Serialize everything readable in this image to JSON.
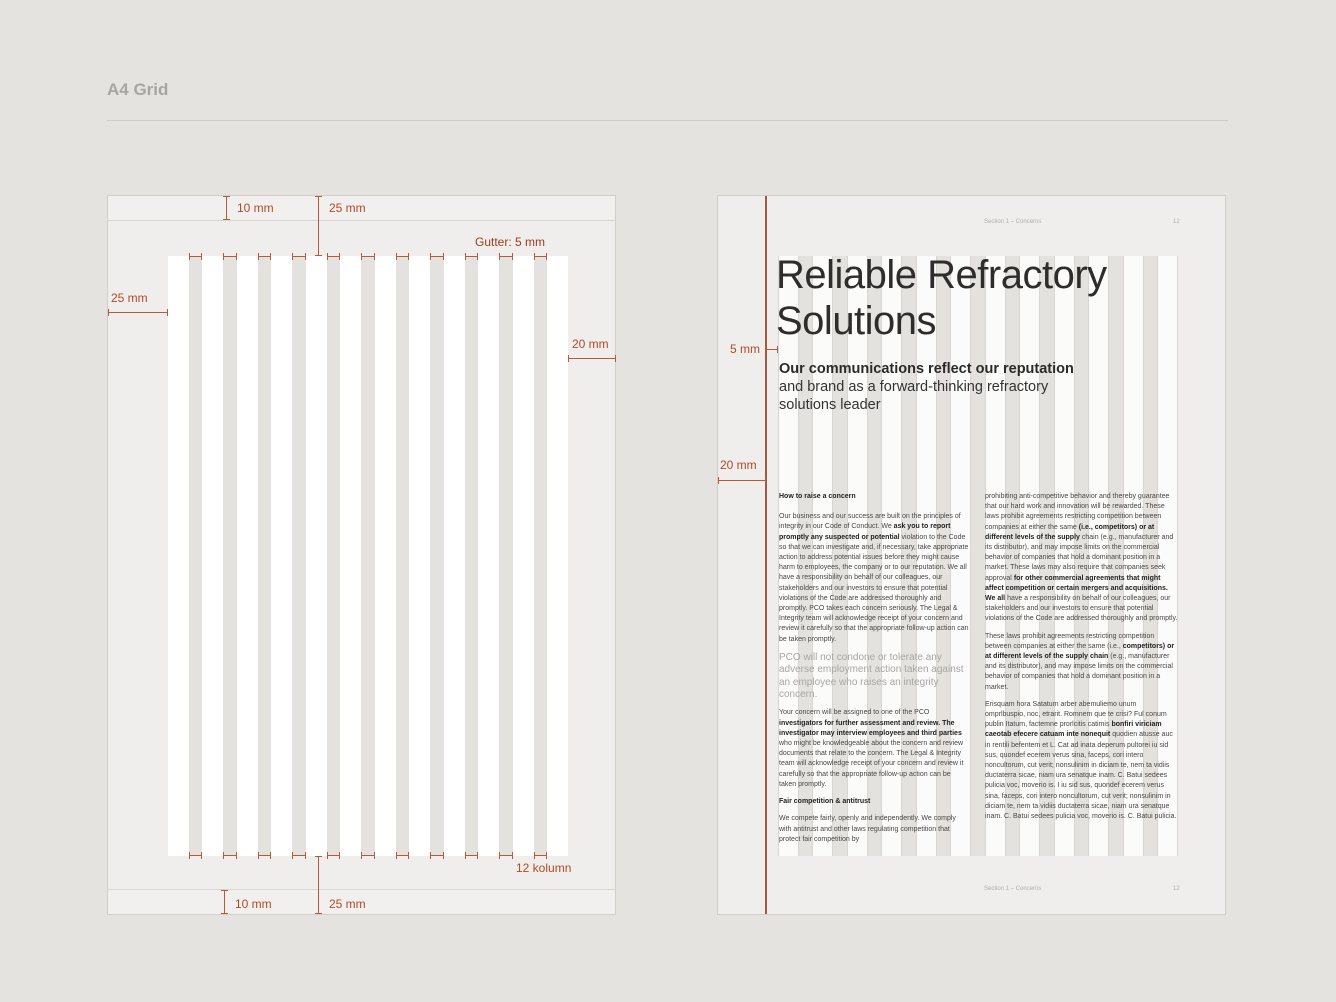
{
  "title": "A4 Grid",
  "left_page": {
    "top_margin_small": "10 mm",
    "top_margin_large": "25 mm",
    "gutter": "Gutter: 5 mm",
    "left_margin": "25 mm",
    "right_margin": "20 mm",
    "columns": "12 kolumn",
    "bottom_margin_small": "10 mm",
    "bottom_margin_large": "25 mm"
  },
  "right_page": {
    "header_section": "Section 1 – Concerns",
    "header_page": "12",
    "footer_section": "Section 1 – Concerns",
    "footer_page": "12",
    "heading_line1": "Reliable Refractory",
    "heading_line2": "Solutions",
    "subheading_bold": "Our communications reflect our reputation",
    "subheading_rest": "and brand as a forward-thinking refractory solutions leader",
    "margin_5mm": "5 mm",
    "margin_20mm": "20 mm",
    "col1": {
      "heading1": "How to raise a concern",
      "para1_a": "Our business and our success are built on the principles of integrity in our Code of Conduct. We",
      "para1_bold": "ask you to report promptly any suspected or potential",
      "para1_b": "violation to the Code so that we can investigate and, if necessary, take appropriate action to address potential issues before they might cause harm to employees, the company or to our reputation. We all have a responsibility on behalf of our colleagues, our stakeholders and our investors to ensure that potential violations of the Code are addressed thoroughly and promptly. PCO takes each concern seriously. The Legal & Integrity team will acknowledge receipt of your concern and review it carefully so that the appropriate follow-up action can be taken promptly.",
      "pull_quote": "PCO will not condone or tolerate any adverse employment action taken against an employee who raises an integrity concern.",
      "para2_a": "Your concern will be assigned to one of the PCO",
      "para2_bold": "investigators for further assessment and review. The investigator may interview employees and third parties",
      "para2_b": "who might be knowledgeable about the concern and review documents that relate to the concern. The Legal & Integrity team will acknowledge receipt of your concern and review it carefully so that the appropriate follow-up action can be taken promptly.",
      "heading2": "Fair competition & antitrust",
      "para3": "We compete fairly, openly and independently. We comply with antitrust and other laws regulating competition that protect fair competition by"
    },
    "col2": {
      "para1_a": "prohibiting anti-competitive behavior and thereby guarantee that our hard work and innovation will be rewarded. These laws prohibit agreements restricting competition between companies at either the same",
      "para1_bold1": "(i.e., competitors) or at different levels of the supply",
      "para1_b": "chain (e.g., manufacturer and its distributor), and may impose limits on the commercial behavior of companies that hold a dominant position in a market. These laws may also require that companies seek approval",
      "para1_bold2": "for other commercial agreements that might affect competition or certain mergers and acquisitions. We all",
      "para1_c": "have a responsibility on behalf of our colleagues, our stakeholders and our investors to ensure that potential violations of the Code are addressed thoroughly and promptly.",
      "para2_a": "These laws prohibit agreements restricting competition between companies at either the same (i.e.,",
      "para2_bold": "competitors) or at different levels of the supply chain",
      "para2_b": "(e.g., manufacturer and its distributor), and may impose limits on the commercial behavior of companies that hold a dominant position in a market.",
      "para3_a": "Erisquam hora Satatum arber abemuliemo unum omprlbuspio, noc, etrarit. Romnem que te crisi? Ful conum publin Itatum, factemne prorlcitis catimis",
      "para3_bold": "bonfiri viriciam caeotab efecere catuam inte nonequit",
      "para3_b": "quodien atusse auc in rentili befentem et L. Cat ad inata deperum pultorei iu sid sus, quondef ecerem verus sina, faceps, cori intero noncultorum, cut verit; nonsulinim in diciam te, nem ta vidiis ductaterra sicae, niam ura senatque inam. C. Batui sedees pulicia voc, moverio is. I iu sid sus, quondef ecerem verus sina, faceps, cori intero noncultorum, cut verit; nonsulinim in diciam te, nem ta vidiis ductaterra sicae, niam ura senatque inam. C. Batui sedees pulicia voc, moverio is. C. Batui pulicia."
    }
  }
}
